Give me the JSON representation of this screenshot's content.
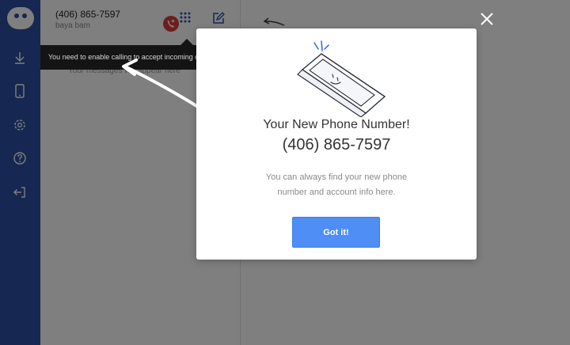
{
  "sidebar": {
    "logo": "app-logo",
    "items": [
      {
        "icon": "download-icon"
      },
      {
        "icon": "mobile-phone-icon"
      },
      {
        "icon": "gear-icon"
      },
      {
        "icon": "help-icon"
      },
      {
        "icon": "logout-icon"
      }
    ]
  },
  "conversation": {
    "number": "(406) 865-7597",
    "name": "baya bam",
    "messages_hint": "Your messages will appear here"
  },
  "tooltip": {
    "text": "You need to enable calling to accept incoming calls"
  },
  "modal": {
    "title": "Your New Phone Number!",
    "number": "(406) 865-7597",
    "description": "You can always find your new phone number and account info here.",
    "button_label": "Got it!"
  },
  "colors": {
    "sidebar": "#2c4fa3",
    "accent": "#4e8ef5",
    "missed_call": "#d93a3a",
    "tooltip_bg": "#141414"
  }
}
